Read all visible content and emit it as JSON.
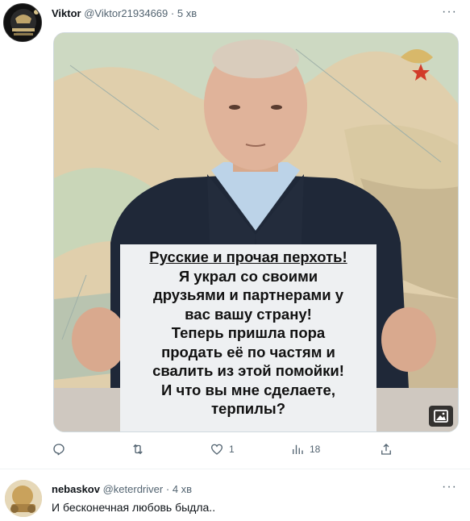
{
  "tweet": {
    "author_name": "Viktor",
    "handle": "@Viktor21934669",
    "separator": "·",
    "time": "5 хв",
    "more": "···",
    "sign_lines": [
      "Русские и прочая перхоть!",
      "Я украл со своими",
      "друзьями и партнерами у",
      "вас вашу страну!",
      "Теперь пришла пора",
      "продать её по частям и",
      "свалить из этой помойки!",
      "И что вы мне сделаете,",
      "терпилы?"
    ],
    "actions": {
      "like_count": "1",
      "views_count": "18"
    }
  },
  "reply": {
    "author_name": "nebaskov",
    "handle": "@keterdriver",
    "separator": "·",
    "time": "4 хв",
    "more": "···",
    "text": "И бесконечная любовь быдла.."
  }
}
